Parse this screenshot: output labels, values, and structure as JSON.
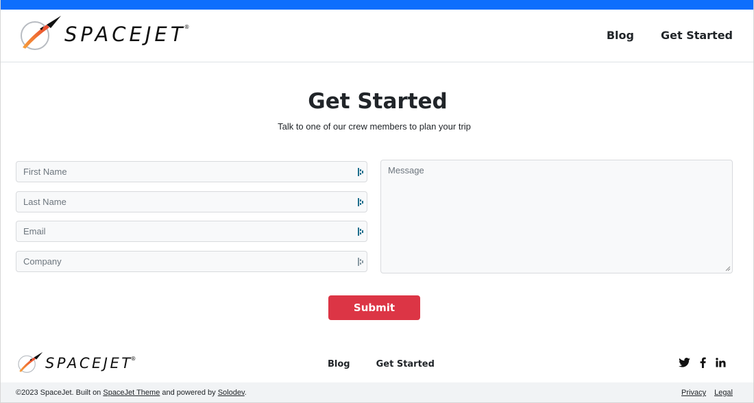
{
  "colors": {
    "accent": "#0d6efd",
    "submit": "#dc3545"
  },
  "header": {
    "brand": "SPACEJET",
    "brand_mark": "®",
    "nav": [
      "Blog",
      "Get Started"
    ]
  },
  "hero": {
    "title": "Get Started",
    "subtitle": "Talk to one of our crew members to plan your trip"
  },
  "form": {
    "first_name_placeholder": "First Name",
    "last_name_placeholder": "Last Name",
    "email_placeholder": "Email",
    "company_placeholder": "Company",
    "message_placeholder": "Message",
    "submit_label": "Submit"
  },
  "footer": {
    "brand": "SPACEJET",
    "brand_mark": "®",
    "nav": [
      "Blog",
      "Get Started"
    ],
    "social_icons": [
      "twitter-icon",
      "facebook-icon",
      "linkedin-icon"
    ],
    "copyright_prefix": "©2023 SpaceJet. Built on ",
    "theme_link": "SpaceJet Theme",
    "powered_text": " and powered by ",
    "solodev_link": "Solodev",
    "period": ".",
    "legal_links": [
      "Privacy",
      "Legal"
    ]
  }
}
